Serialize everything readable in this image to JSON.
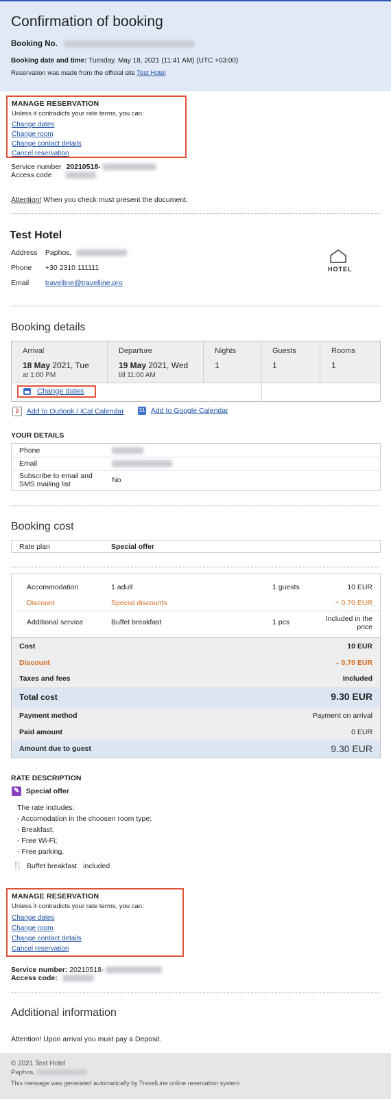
{
  "header": {
    "title": "Confirmation of booking",
    "booking_no_label": "Booking No.",
    "booking_date_label": "Booking date and time:",
    "booking_date_value": "Tuesday, May 18, 2021 (11:41 AM) (UTC +03:00)",
    "reservation_source_text": "Reservation was made from the official site",
    "reservation_source_link": "Test Hotel"
  },
  "manage_top": {
    "title": "MANAGE RESERVATION",
    "subtitle": "Unless it contradicts your rate terms, you can:",
    "links": [
      "Change dates",
      "Change room",
      "Change contact details",
      "Cancel reservation"
    ]
  },
  "service": {
    "service_label": "Service number",
    "service_value": "20210518-",
    "access_label": "Access code"
  },
  "attention": {
    "label": "Attention!",
    "text": " When you check must present the document."
  },
  "hotel": {
    "name": "Test Hotel",
    "address_label": "Address",
    "address_value": "Paphos,",
    "phone_label": "Phone",
    "phone_value": "+30 2310 111111",
    "email_label": "Email",
    "email_value": "travelline@travelline.pro",
    "logo_text": "HOTEL"
  },
  "booking_details": {
    "title": "Booking details",
    "arrival_label": "Arrival",
    "arrival_day": "18 May",
    "arrival_rest": " 2021, Tue",
    "arrival_time": "at 1:00 PM",
    "departure_label": "Departure",
    "departure_day": "19 May",
    "departure_rest": " 2021, Wed",
    "departure_time": "till 11:00 AM",
    "nights_label": "Nights",
    "nights_value": "1",
    "guests_label": "Guests",
    "guests_value": "1",
    "rooms_label": "Rooms",
    "rooms_value": "1",
    "change_dates": "Change dates",
    "outlook_link": "Add to Outlook / iCal Calendar",
    "outlook_icon_num": "9",
    "google_link": "Add to Google Calendar",
    "google_icon_num": "31"
  },
  "your_details": {
    "title": "YOUR DETAILS",
    "phone_label": "Phone",
    "email_label": "Email",
    "subscribe_label_1": "Subscribe to email and",
    "subscribe_label_2": "SMS mailing list",
    "subscribe_value": "No"
  },
  "booking_cost": {
    "title": "Booking cost",
    "rate_plan_label": "Rate plan",
    "rate_plan_value": "Special offer",
    "items": [
      {
        "name": "Accommodation",
        "desc": "1 adult",
        "qty": "1 guests",
        "price": "10 EUR",
        "style": "normal"
      },
      {
        "name": "Discount",
        "desc": "Special discounts",
        "qty": "",
        "price": "− 0.70 EUR",
        "style": "discount"
      },
      {
        "name": "Additional service",
        "desc": "Buffet breakfast",
        "qty": "1 pcs",
        "price": "Included in the price",
        "style": "normal"
      }
    ],
    "cost_label": "Cost",
    "cost_value": "10 EUR",
    "discount_label": "Discount",
    "discount_value": "– 0.70 EUR",
    "taxes_label": "Taxes and fees",
    "taxes_value": "Included",
    "total_label": "Total cost",
    "total_value": "9.30 EUR",
    "payment_method_label": "Payment method",
    "payment_method_value": "Payment on arrival",
    "paid_label": "Paid amount",
    "paid_value": "0 EUR",
    "due_label": "Amount due to guest",
    "due_value": "9.30 EUR"
  },
  "rate_description": {
    "title": "RATE DESCRIPTION",
    "offer_name": "Special offer",
    "lines": [
      "The rate includes:",
      "- Accomodation in the choosen room type;",
      "- Breakfast;",
      "- Free Wi-Fi;",
      "- Free parking."
    ],
    "service_name": "Buffet breakfast",
    "service_status": "included"
  },
  "manage_bottom": {
    "title": "MANAGE RESERVATION",
    "subtitle": "Unless it contradicts your rate terms, you can:",
    "links": [
      "Change dates",
      "Change room",
      "Change contact details",
      "Cancel reservation"
    ]
  },
  "service_bottom": {
    "service_label": "Service number:",
    "service_value": "20210518-",
    "access_label": "Access code:"
  },
  "additional": {
    "title": "Additional information",
    "text": "Attention! Upon arrival you must pay a Deposit."
  },
  "footer": {
    "copyright": "© 2021 Test Hotel",
    "city": "Paphos,",
    "note": "This message was generated automatically by TravelLine online reservation system"
  },
  "colors": {
    "header_bg": "#e1e9f6",
    "accent_border": "#e0533a",
    "link": "#1b4fa5",
    "discount": "#d2691e",
    "total_bg": "#dce6f3"
  }
}
